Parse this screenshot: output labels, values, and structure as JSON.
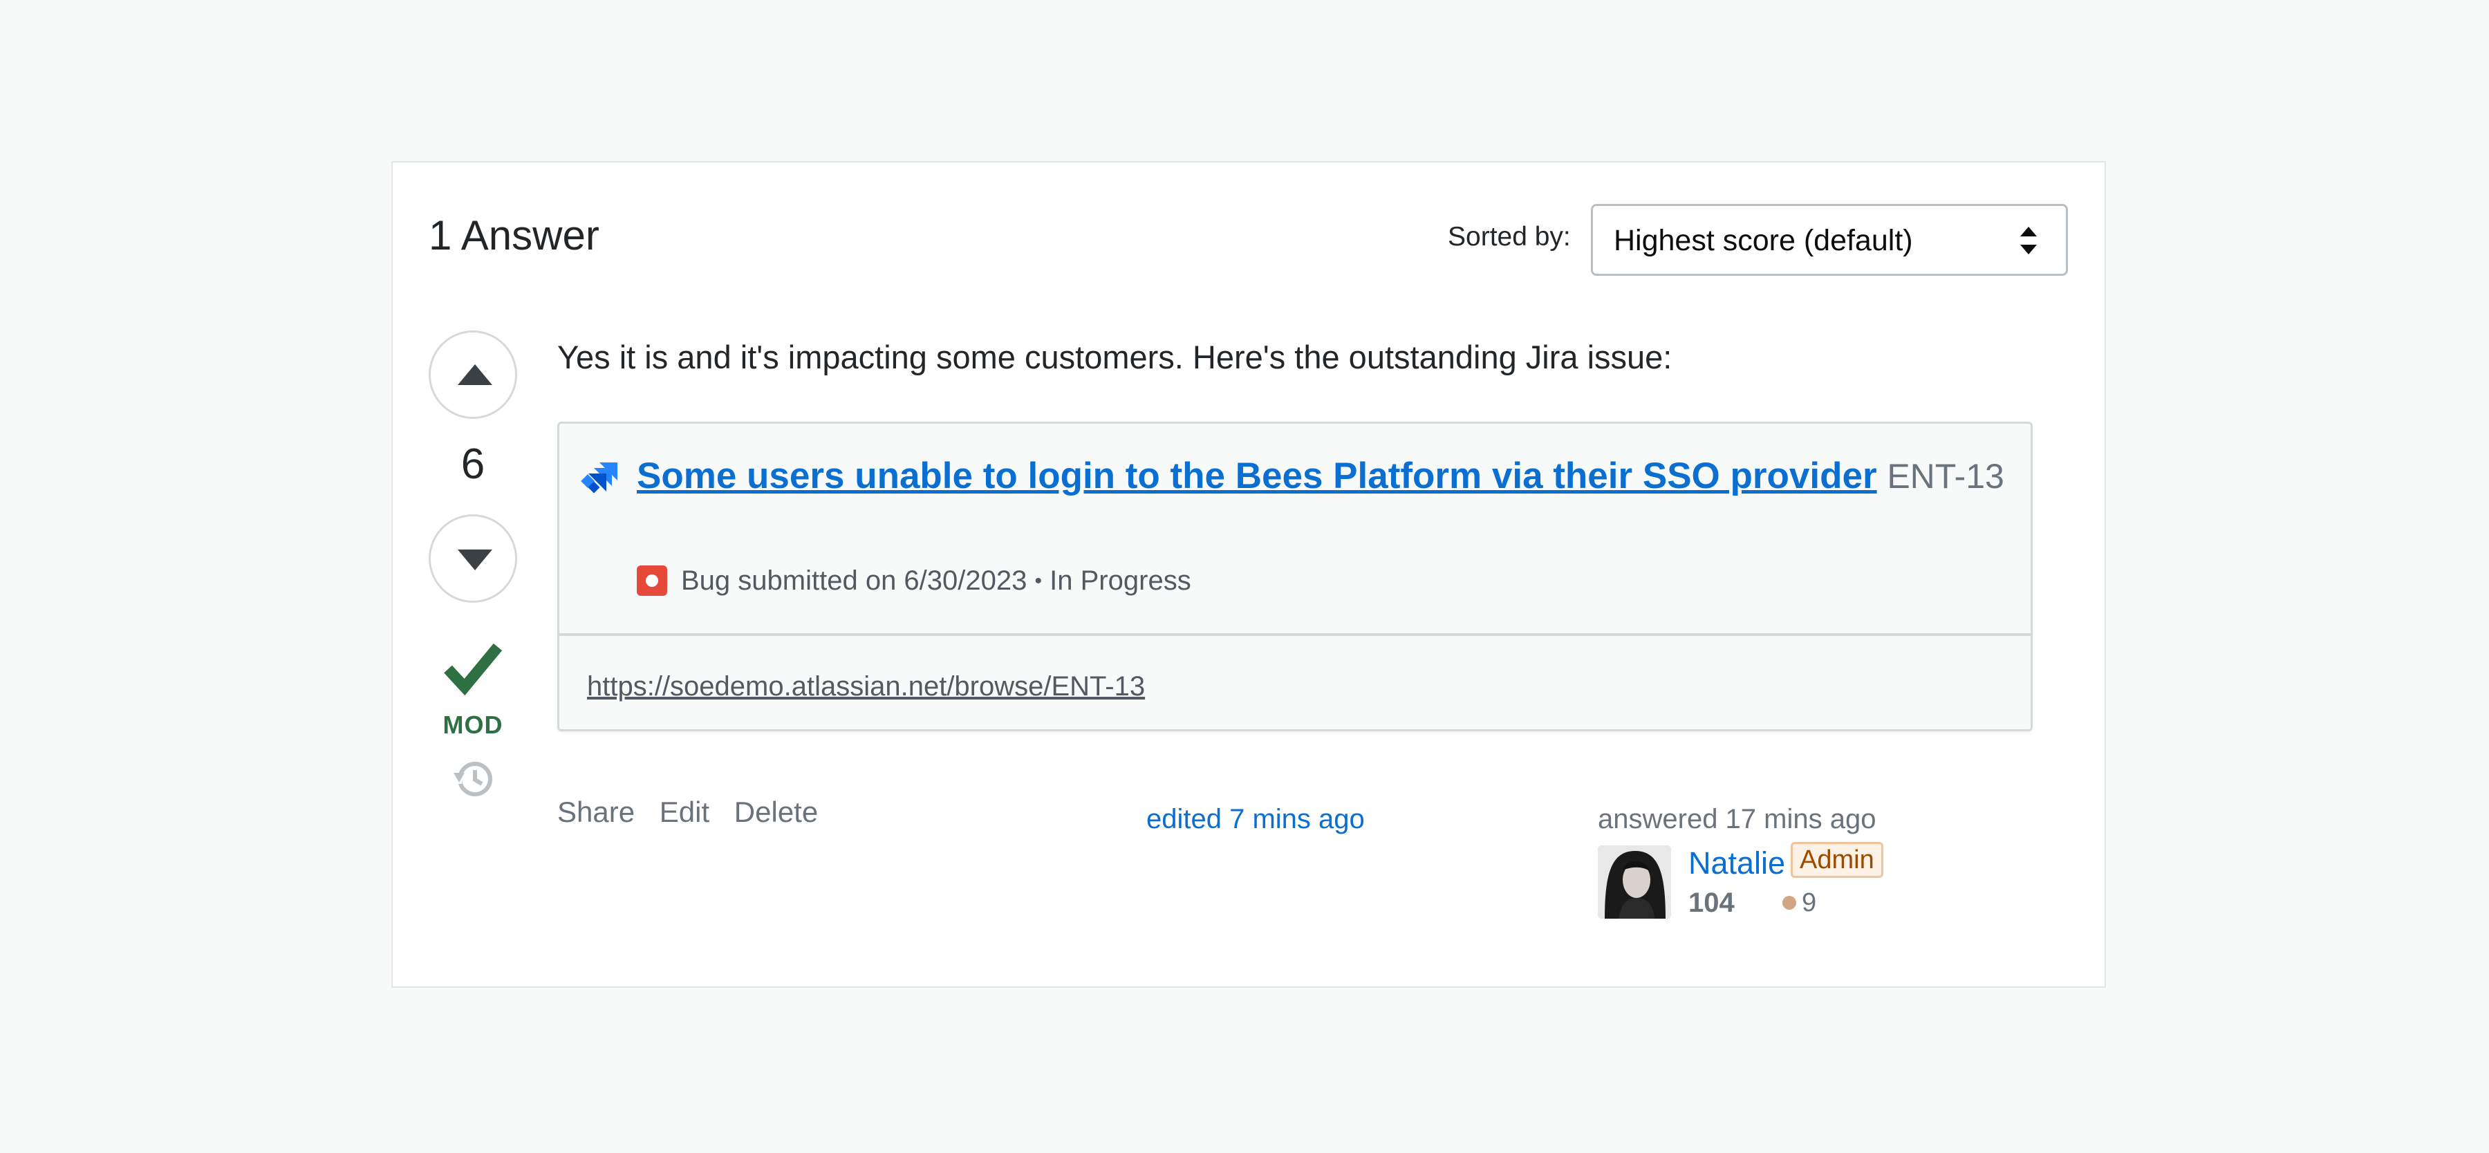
{
  "header": {
    "answers_title": "1 Answer",
    "sort_label": "Sorted by:",
    "sort_selected": "Highest score (default)"
  },
  "vote": {
    "count": "6",
    "up_icon": "triangle-up-icon",
    "down_icon": "triangle-down-icon",
    "accepted_icon": "checkmark-icon",
    "mod_label": "MOD",
    "history_icon": "history-icon"
  },
  "answer": {
    "text": "Yes it is and it's impacting some customers. Here's the outstanding Jira issue:"
  },
  "jira": {
    "title": "Some users unable to login to the Bees Platform via their SSO provider",
    "key": "ENT-13",
    "type": "Bug",
    "submitted": "submitted on 6/30/2023",
    "separator": "•",
    "status": "In Progress",
    "url": "https://soedemo.atlassian.net/browse/ENT-13",
    "logo_icon": "jira-logo-icon",
    "type_icon": "bug-icon"
  },
  "actions": {
    "share": "Share",
    "edit": "Edit",
    "delete": "Delete"
  },
  "meta": {
    "edited": "edited 7 mins ago",
    "answered": "answered 17 mins ago",
    "user_name": "Natalie",
    "user_badge": "Admin",
    "reputation": "104",
    "bronze_badges": "9"
  },
  "colors": {
    "link": "#0a6fd0",
    "accepted": "#2f6f44",
    "bug": "#e5493a",
    "admin_badge_bg": "#fdf0e4"
  }
}
